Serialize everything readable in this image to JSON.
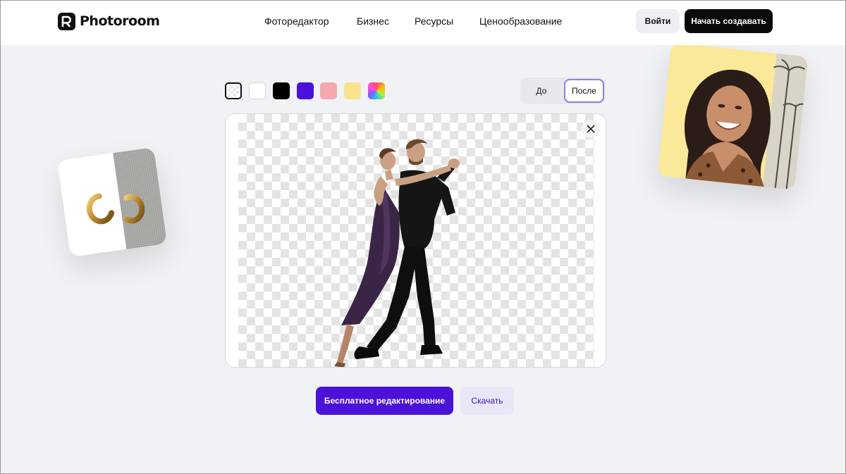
{
  "brand": {
    "name": "Photoroom"
  },
  "nav": {
    "items": [
      {
        "label": "Фоторедактор"
      },
      {
        "label": "Бизнес"
      },
      {
        "label": "Ресурсы"
      },
      {
        "label": "Ценообразование"
      }
    ],
    "login_label": "Войти",
    "start_label": "Начать создавать"
  },
  "editor": {
    "swatches": [
      {
        "name": "transparent",
        "color": "transparent",
        "selected": true
      },
      {
        "name": "white",
        "color": "#ffffff"
      },
      {
        "name": "black",
        "color": "#000000"
      },
      {
        "name": "purple",
        "color": "#4a12d8"
      },
      {
        "name": "pink",
        "color": "#f5a9ad"
      },
      {
        "name": "yellow",
        "color": "#fbe38e"
      },
      {
        "name": "gradient",
        "color": "multicolor"
      }
    ],
    "toggle": {
      "before_label": "До",
      "after_label": "После",
      "active": "after"
    },
    "close_icon": "close-icon",
    "edit_label": "Бесплатное редактирование",
    "download_label": "Скачать"
  },
  "colors": {
    "accent": "#4a12d8",
    "background": "#f1f2f6",
    "header": "#ffffff",
    "primary_dark": "#0b0b0b"
  }
}
